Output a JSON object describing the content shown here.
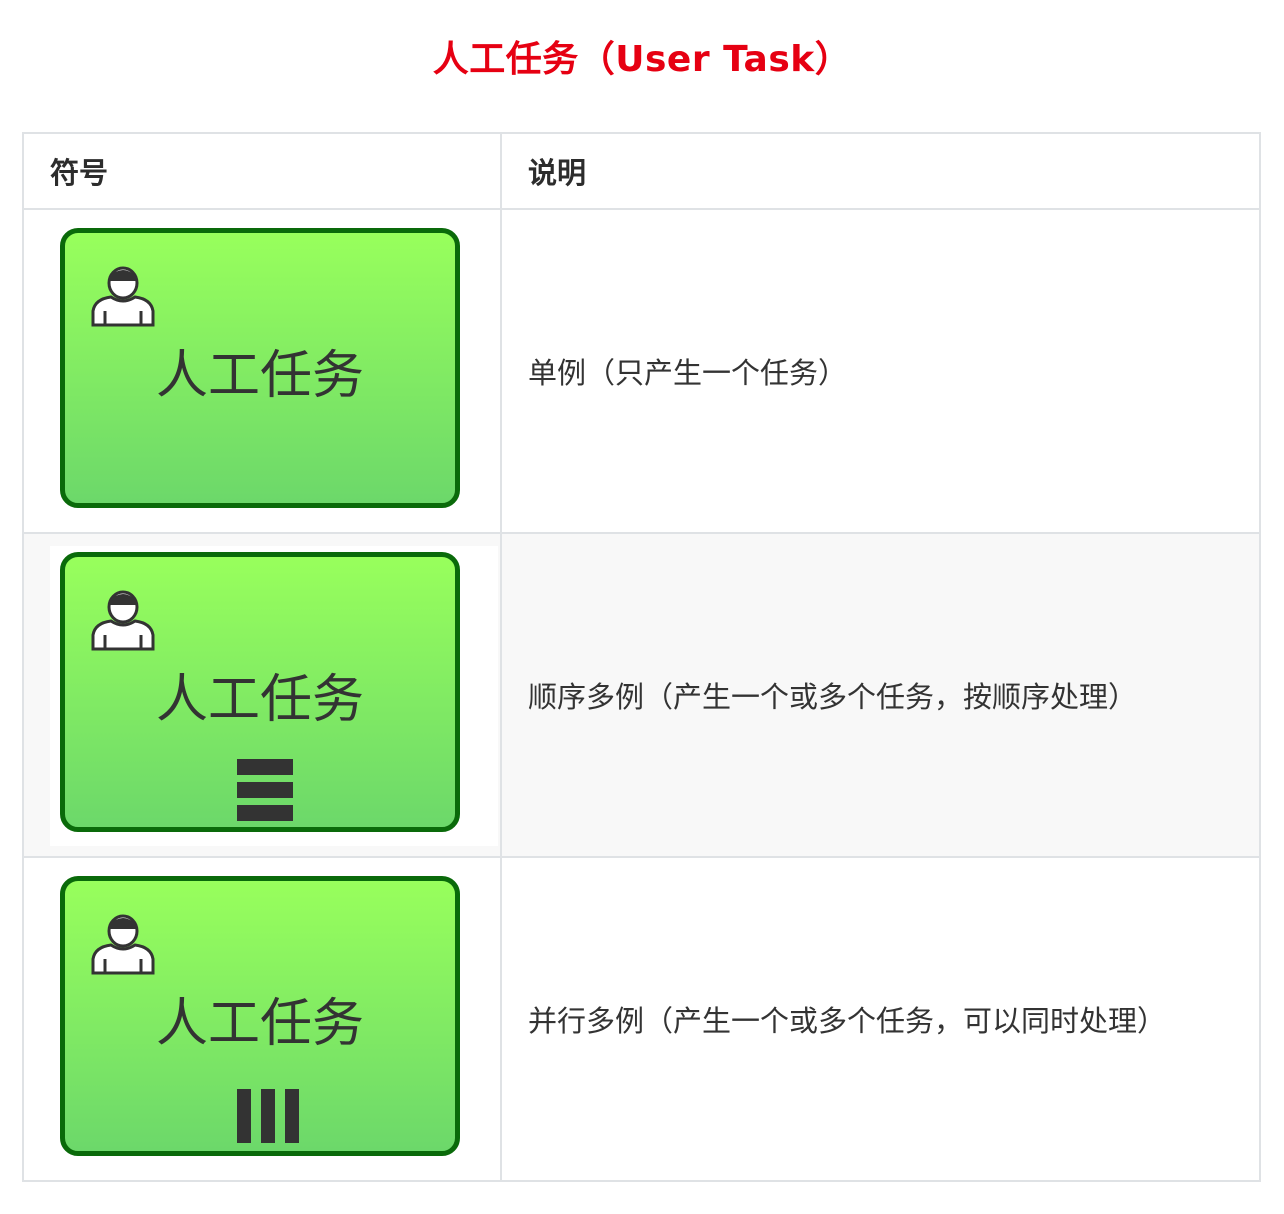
{
  "page": {
    "title": "人工任务（User Task）"
  },
  "table": {
    "headers": [
      "符号",
      "说明"
    ],
    "rows": [
      {
        "shape_label": "人工任务",
        "marker": "none",
        "description": "单例（只产生一个任务）"
      },
      {
        "shape_label": "人工任务",
        "marker": "sequential-multi-instance",
        "description": "顺序多例（产生一个或多个任务，按顺序处理）"
      },
      {
        "shape_label": "人工任务",
        "marker": "parallel-multi-instance",
        "description": "并行多例（产生一个或多个任务，可以同时处理）"
      }
    ]
  },
  "colors": {
    "title": "#e60012",
    "shape_fill_top": "#98ff5c",
    "shape_fill_bottom": "#6cd86a",
    "shape_border": "#0a6a0a",
    "table_border": "#dfe2e5",
    "row_alt_bg": "#f8f8f8"
  },
  "icons": {
    "task_type": "user-icon",
    "sequential": "sequential-marker-icon",
    "parallel": "parallel-marker-icon"
  }
}
